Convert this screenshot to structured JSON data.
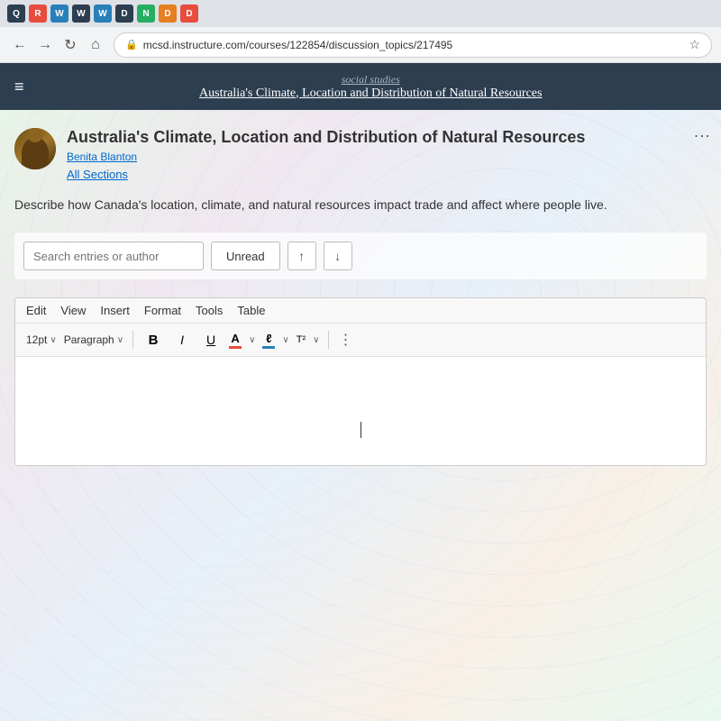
{
  "browser": {
    "address": "mcsd.instructure.com/courses/122854/discussion_topics/217495",
    "back_label": "←",
    "forward_label": "→",
    "refresh_label": "↻",
    "home_label": "⌂",
    "lock_icon": "🔒",
    "star_icon": "☆"
  },
  "canvas_nav": {
    "hamburger": "≡",
    "course_subtitle": "social studies",
    "course_title": "Australia's Climate, Location and Distribution of Natural Resources"
  },
  "discussion": {
    "title": "Australia's Climate, Location and Distribution of Natural Resources",
    "author": "Benita Blanton",
    "sections_label": "All Sections",
    "description": "Describe how Canada's location, climate, and natural resources impact trade and affect where people live."
  },
  "search": {
    "placeholder": "Search entries or author",
    "unread_label": "Unread",
    "sort_up": "↑",
    "sort_down": "↓"
  },
  "editor": {
    "menu": {
      "edit": "Edit",
      "view": "View",
      "insert": "Insert",
      "format": "Format",
      "tools": "Tools",
      "table": "Table"
    },
    "toolbar": {
      "font_size": "12pt",
      "paragraph": "Paragraph",
      "bold": "B",
      "italic": "I",
      "underline": "U",
      "font_color": "A",
      "highlight": "ℓ",
      "superscript": "T²",
      "more_dots": "⋮"
    }
  },
  "dots_menu": "⋮",
  "tab_icons": [
    {
      "label": "Q",
      "color": "dark"
    },
    {
      "label": "R",
      "color": "red"
    },
    {
      "label": "W",
      "color": "blue"
    },
    {
      "label": "W",
      "color": "dark"
    },
    {
      "label": "W",
      "color": "blue"
    },
    {
      "label": "D",
      "color": "dark"
    },
    {
      "label": "N",
      "color": "green"
    },
    {
      "label": "D",
      "color": "orange"
    },
    {
      "label": "D",
      "color": "red"
    }
  ]
}
